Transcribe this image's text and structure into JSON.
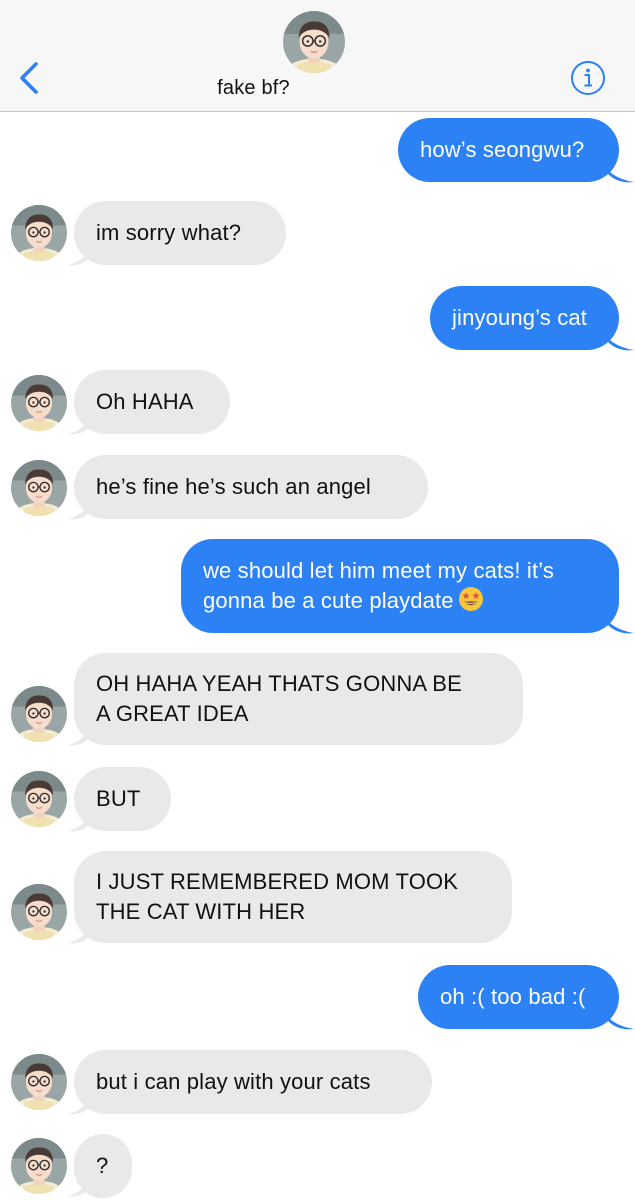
{
  "header": {
    "contact_name": "fake bf?",
    "back_icon": "chevron-left-icon",
    "info_icon": "info-icon"
  },
  "colors": {
    "outgoing_bubble": "#2c81f4",
    "incoming_bubble": "#e9e9eb",
    "accent": "#2c81f4"
  },
  "messages": [
    {
      "direction": "out",
      "text": "how’s seongwu?"
    },
    {
      "direction": "in",
      "text": "im sorry what?"
    },
    {
      "direction": "out",
      "text": "jinyoung’s cat"
    },
    {
      "direction": "in",
      "text": "Oh HAHA"
    },
    {
      "direction": "in",
      "text": "he’s fine he’s such an angel"
    },
    {
      "direction": "out",
      "line1": "we should let him meet my cats! it’s",
      "line2": "gonna be a cute playdate",
      "emoji": "star-struck-emoji"
    },
    {
      "direction": "in",
      "line1": "OH HAHA YEAH THATS GONNA BE",
      "line2": "A GREAT IDEA"
    },
    {
      "direction": "in",
      "text": "BUT"
    },
    {
      "direction": "in",
      "line1": "I JUST REMEMBERED MOM TOOK",
      "line2": "THE CAT WITH HER"
    },
    {
      "direction": "out",
      "text": "oh :( too bad :("
    },
    {
      "direction": "in",
      "text": "but i can play with your cats"
    },
    {
      "direction": "in",
      "text": "?"
    }
  ]
}
